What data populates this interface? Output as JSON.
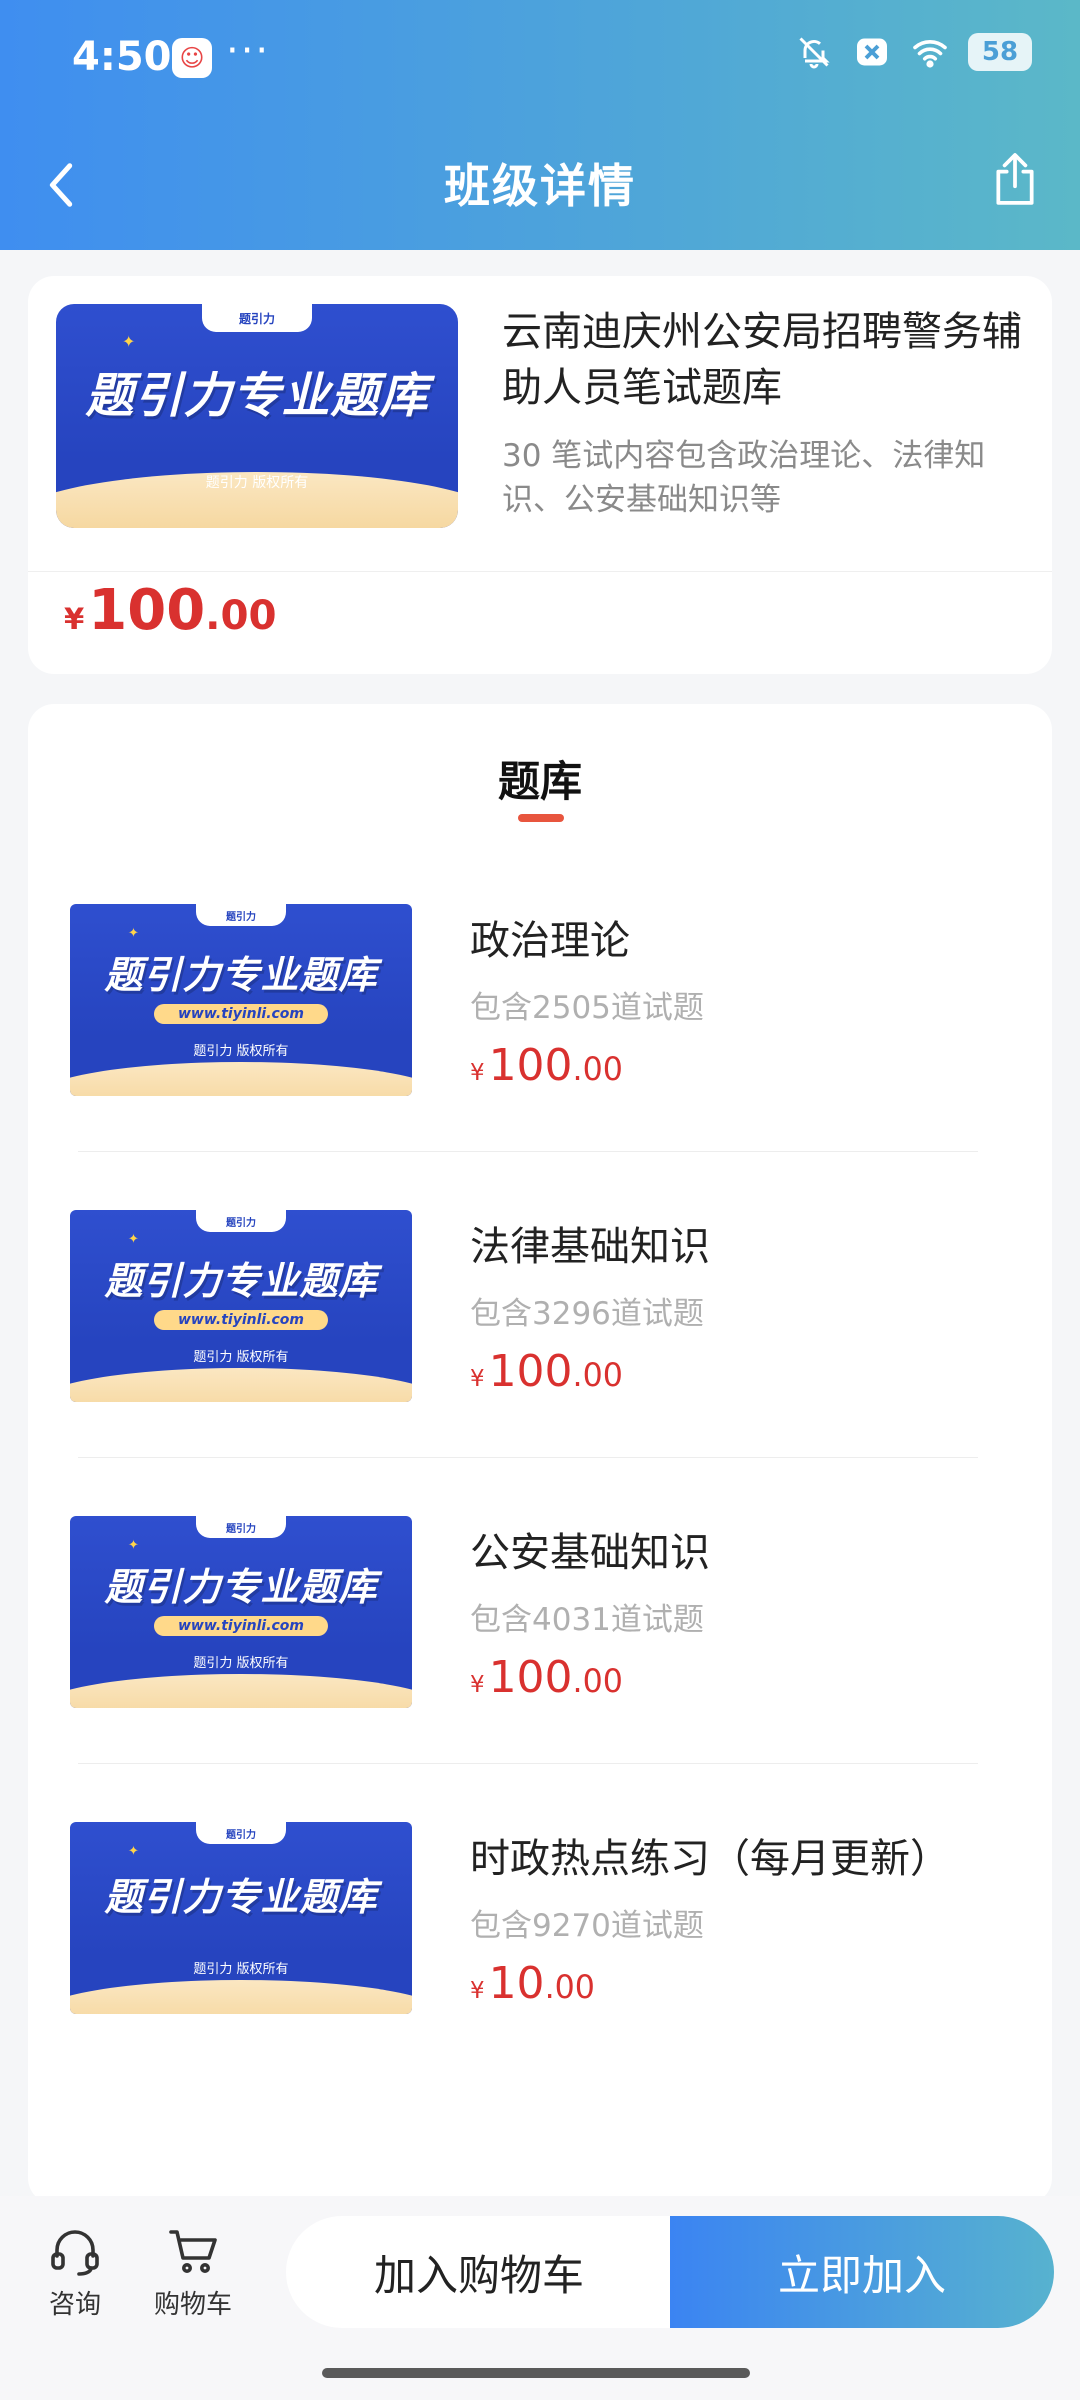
{
  "status_bar": {
    "time": "4:50",
    "dots": "···",
    "battery": "58"
  },
  "nav": {
    "title": "班级详情"
  },
  "thumbnail": {
    "logo": "题引力",
    "banner": "题引力专业题库",
    "url": "www.tiyinli.com",
    "copyright": "题引力 版权所有"
  },
  "course": {
    "title": "云南迪庆州公安局招聘警务辅助人员笔试题库",
    "description": "30 笔试内容包含政治理论、法律知识、公安基础知识等",
    "price": {
      "currency": "¥",
      "integer": "100",
      "decimal": ".00"
    }
  },
  "section": {
    "title": "题库"
  },
  "items": [
    {
      "name": "政治理论",
      "count": "包含2505道试题",
      "currency": "¥",
      "integer": "100",
      "decimal": ".00"
    },
    {
      "name": "法律基础知识",
      "count": "包含3296道试题",
      "currency": "¥",
      "integer": "100",
      "decimal": ".00"
    },
    {
      "name": "公安基础知识",
      "count": "包含4031道试题",
      "currency": "¥",
      "integer": "100",
      "decimal": ".00"
    },
    {
      "name": "时政热点练习（每月更新）",
      "count": "包含9270道试题",
      "currency": "¥",
      "integer": "10",
      "decimal": ".00"
    }
  ],
  "bottom_bar": {
    "consult": "咨询",
    "cart": "购物车",
    "add_to_cart": "加入购物车",
    "join_now": "立即加入"
  },
  "colors": {
    "accent": "#3f8ef0",
    "price": "#d9312f",
    "underline": "#e8553e"
  }
}
